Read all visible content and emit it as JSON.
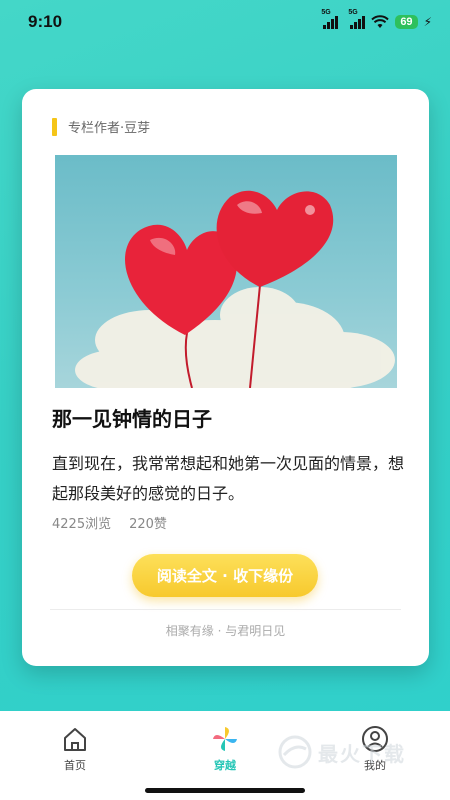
{
  "status": {
    "time": "9:10",
    "signal1_label": "5G",
    "signal2_label": "5G",
    "battery": "69"
  },
  "card": {
    "author": "专栏作者·豆芽",
    "title": "那一见钟情的日子",
    "body": "直到现在，我常常想起和她第一次见面的情景，想起那段美好的感觉的日子。",
    "views": "4225浏览",
    "likes": "220赞",
    "cta_label": "阅读全文 · 收下缘份",
    "footer": "相聚有缘 · 与君明日见"
  },
  "nav": {
    "items": [
      {
        "label": "首页",
        "icon": "home-icon",
        "active": false
      },
      {
        "label": "穿越",
        "icon": "pinwheel-icon",
        "active": true
      },
      {
        "label": "我的",
        "icon": "profile-icon",
        "active": false
      }
    ]
  },
  "watermark": {
    "text": "最火下载"
  },
  "colors": {
    "accent": "#25c6b6",
    "button": "#f7c92d",
    "author_bar": "#f5c518",
    "background": "#36cfc5"
  }
}
